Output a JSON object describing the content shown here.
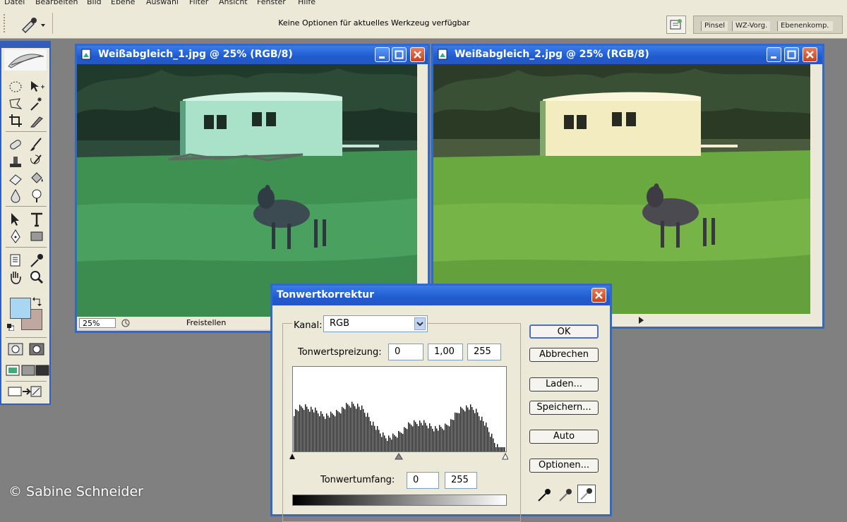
{
  "menu": [
    "Datei",
    "Bearbeiten",
    "Bild",
    "Ebene",
    "Auswahl",
    "Filter",
    "Ansicht",
    "Fenster",
    "Hilfe"
  ],
  "options_bar": {
    "message": "Keine Optionen für aktuelles Werkzeug verfügbar",
    "palette_tabs": [
      "Pinsel",
      "WZ-Vorg.",
      "Ebenenkomp."
    ]
  },
  "windows": [
    {
      "title": "Weißabgleich_1.jpg @ 25% (RGB/8)",
      "zoom": "25%",
      "status": "Freistellen"
    },
    {
      "title": "Weißabgleich_2.jpg @ 25% (RGB/8)"
    }
  ],
  "dialog": {
    "title": "Tonwertkorrektur",
    "channel_label": "Kanal:",
    "channel_value": "RGB",
    "input_levels_label": "Tonwertspreizung:",
    "input_levels": [
      "0",
      "1,00",
      "255"
    ],
    "output_levels_label": "Tonwertumfang:",
    "output_levels": [
      "0",
      "255"
    ],
    "buttons": {
      "ok": "OK",
      "cancel": "Abbrechen",
      "load": "Laden...",
      "save": "Speichern...",
      "auto": "Auto",
      "options": "Optionen..."
    }
  },
  "colors": {
    "foreground": "#a9d7f3",
    "background": "#c0a8a0",
    "title_bar": "#2458c8"
  },
  "credit": "© Sabine Schneider"
}
